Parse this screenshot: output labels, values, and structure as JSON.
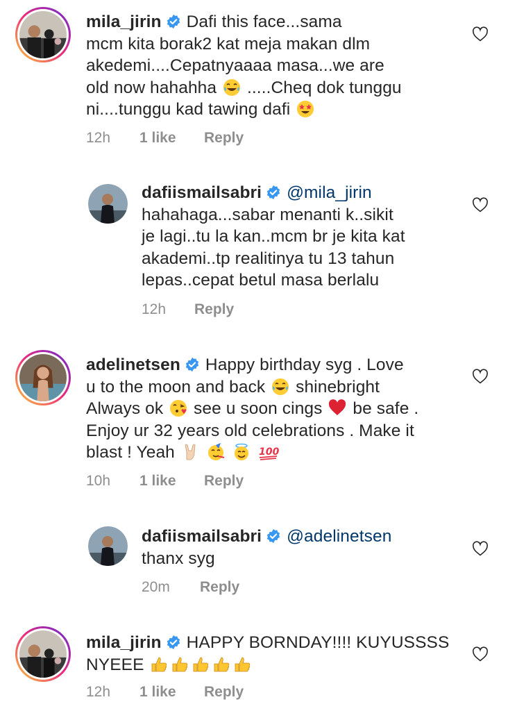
{
  "comments": [
    {
      "username": "mila_jirin",
      "lines": [
        "Dafi this face...sama",
        "mcm kita borak2 kat meja makan dlm",
        "akedemi....Cepatnyaaaa masa...we are",
        "old now hahahha",
        ".....Cheq dok tunggu",
        "ni....tunggu kad tawing dafi"
      ],
      "time": "12h",
      "likes": "1 like",
      "reply": "Reply"
    },
    {
      "username": "dafiismailsabri",
      "mention": "@mila_jirin",
      "lines": [
        "hahahaga...sabar menanti k..sikit",
        "je lagi..tu la kan..mcm br je kita kat",
        "akademi..tp realitinya tu 13 tahun",
        "lepas..cepat betul masa berlalu"
      ],
      "time": "12h",
      "reply": "Reply"
    },
    {
      "username": "adelinetsen",
      "lines": [
        "Happy birthday syg . Love",
        "u to the moon and back",
        "shinebright",
        "Always ok",
        "see u soon cings",
        "be safe .",
        "Enjoy ur 32 years old celebrations . Make it",
        "blast ! Yeah"
      ],
      "time": "10h",
      "likes": "1 like",
      "reply": "Reply"
    },
    {
      "username": "dafiismailsabri",
      "mention": "@adelinetsen",
      "lines": [
        "thanx syg"
      ],
      "time": "20m",
      "reply": "Reply"
    },
    {
      "username": "mila_jirin",
      "lines": [
        "HAPPY BORNDAY!!!! KUYUSSSS",
        "NYEEE"
      ],
      "time": "12h",
      "likes": "1 like",
      "reply": "Reply"
    }
  ],
  "icons": {
    "verified": "verified-badge-icon",
    "heart": "heart-outline-icon",
    "emoji_laugh": "face-with-tears-of-joy",
    "emoji_starstruck": "star-struck",
    "emoji_kiss": "face-blowing-kiss",
    "emoji_heart": "red-heart",
    "emoji_rock": "sign-of-the-horns",
    "emoji_party": "partying-face",
    "emoji_halo": "smiling-face-with-halo",
    "emoji_100": "hundred-points",
    "emoji_thumbs": "thumbs-up"
  },
  "colors": {
    "verified": "#3897f0",
    "mention": "#00376b",
    "meta": "#8e8e8e"
  }
}
